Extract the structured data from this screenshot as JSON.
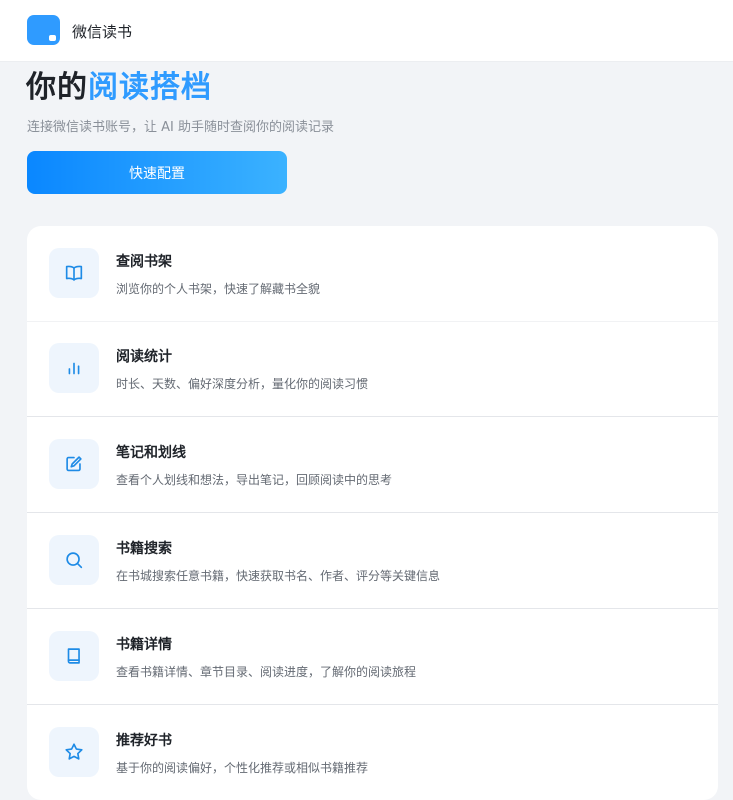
{
  "header": {
    "app_name": "微信读书",
    "logo_icon": "chat-bubble-logo-icon"
  },
  "hero": {
    "title_plain": "你的",
    "title_accent": "阅读搭档",
    "subtitle": "连接微信读书账号，让 AI 助手随时查阅你的阅读记录",
    "cta_label": "快速配置"
  },
  "features": [
    {
      "icon": "open-book-icon",
      "title": "查阅书架",
      "desc": "浏览你的个人书架，快速了解藏书全貌"
    },
    {
      "icon": "bar-chart-icon",
      "title": "阅读统计",
      "desc": "时长、天数、偏好深度分析，量化你的阅读习惯"
    },
    {
      "icon": "edit-icon",
      "title": "笔记和划线",
      "desc": "查看个人划线和想法，导出笔记，回顾阅读中的思考"
    },
    {
      "icon": "search-icon",
      "title": "书籍搜索",
      "desc": "在书城搜索任意书籍，快速获取书名、作者、评分等关键信息"
    },
    {
      "icon": "book-icon",
      "title": "书籍详情",
      "desc": "查看书籍详情、章节目录、阅读进度，了解你的阅读旅程"
    },
    {
      "icon": "star-icon",
      "title": "推荐好书",
      "desc": "基于你的阅读偏好，个性化推荐或相似书籍推荐"
    }
  ],
  "colors": {
    "accent": "#2f9bff",
    "background": "#f2f4f7",
    "icon_tile": "#eef5fd"
  }
}
